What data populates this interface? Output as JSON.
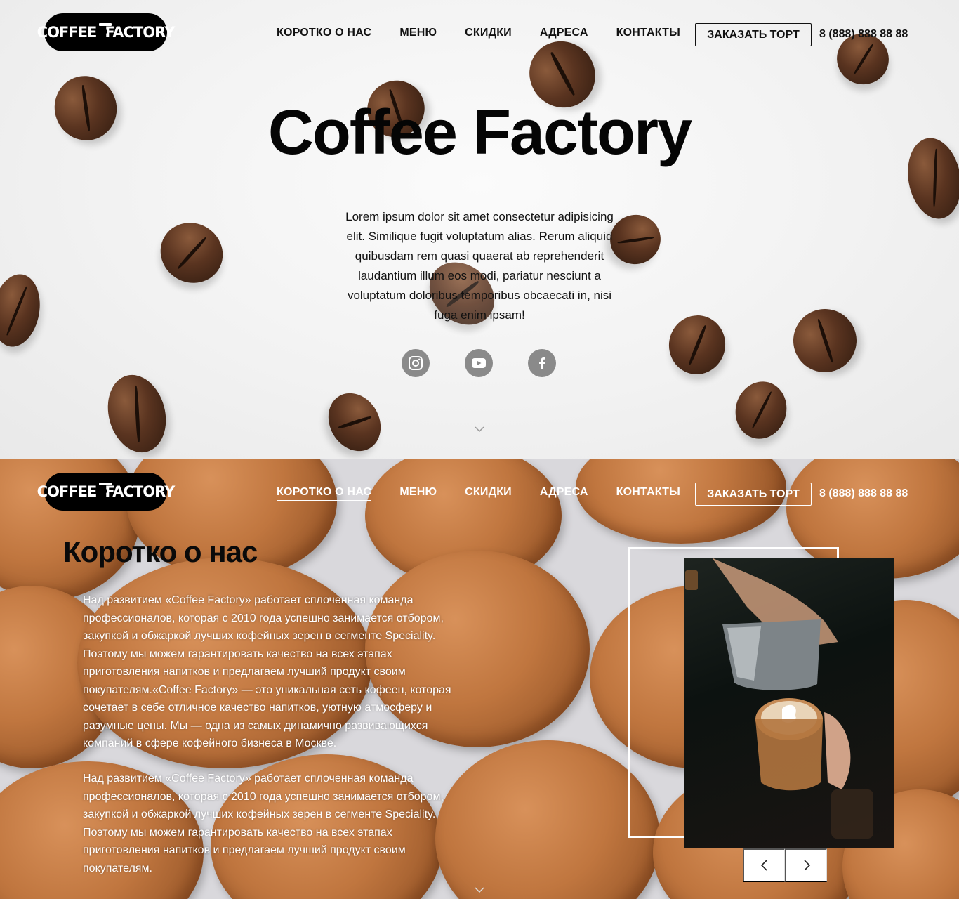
{
  "brand": {
    "logo_text_left": "COFFEE",
    "logo_text_right": "FACTORY"
  },
  "nav": {
    "items": [
      {
        "label": "КОРОТКО О НАС"
      },
      {
        "label": "МЕНЮ"
      },
      {
        "label": "СКИДКИ"
      },
      {
        "label": "АДРЕСА"
      },
      {
        "label": "КОНТАКТЫ"
      }
    ],
    "order_button": "ЗАКАЗАТЬ ТОРТ",
    "phone": "8 (888) 888 88 88"
  },
  "hero": {
    "title": "Coffee Factory",
    "text": "Lorem ipsum dolor sit amet consectetur adipisicing elit. Similique fugit voluptatum alias. Rerum aliquid quibusdam rem quasi quaerat ab reprehenderit laudantium illum eos modi, pariatur nesciunt a voluptatum doloribus temporibus obcaecati in, nisi fuga enim ipsam!",
    "socials": [
      "instagram-icon",
      "youtube-icon",
      "facebook-icon"
    ]
  },
  "about": {
    "title": "Коротко о нас",
    "paragraphs": [
      "Над развитием «Coffee Factory» работает сплоченная команда профессионалов, которая с 2010 года успешно занимается отбором, закупкой и обжаркой лучших кофейных зерен в сегменте Speciality. Поэтому мы можем гарантировать качество на всех этапах приготовления напитков и предлагаем лучший продукт своим покупателям.«Coffee Factory» — это уникальная сеть кофеен, которая сочетает в себе отличное качество напитков, уютную атмосферу и разумные цены. Мы — одна из самых динамично развивающихся компаний в сфере кофейного бизнеса в Москве.",
      "Над развитием «Coffee Factory» работает сплоченная команда профессионалов, которая с 2010 года успешно занимается отбором, закупкой и обжаркой лучших кофейных зерен в сегменте Speciality. Поэтому мы можем гарантировать качество на всех этапах приготовления напитков и предлагаем лучший продукт своим покупателям."
    ]
  },
  "colors": {
    "accent": "#000000",
    "social_icon_bg": "#8a8a8a"
  }
}
